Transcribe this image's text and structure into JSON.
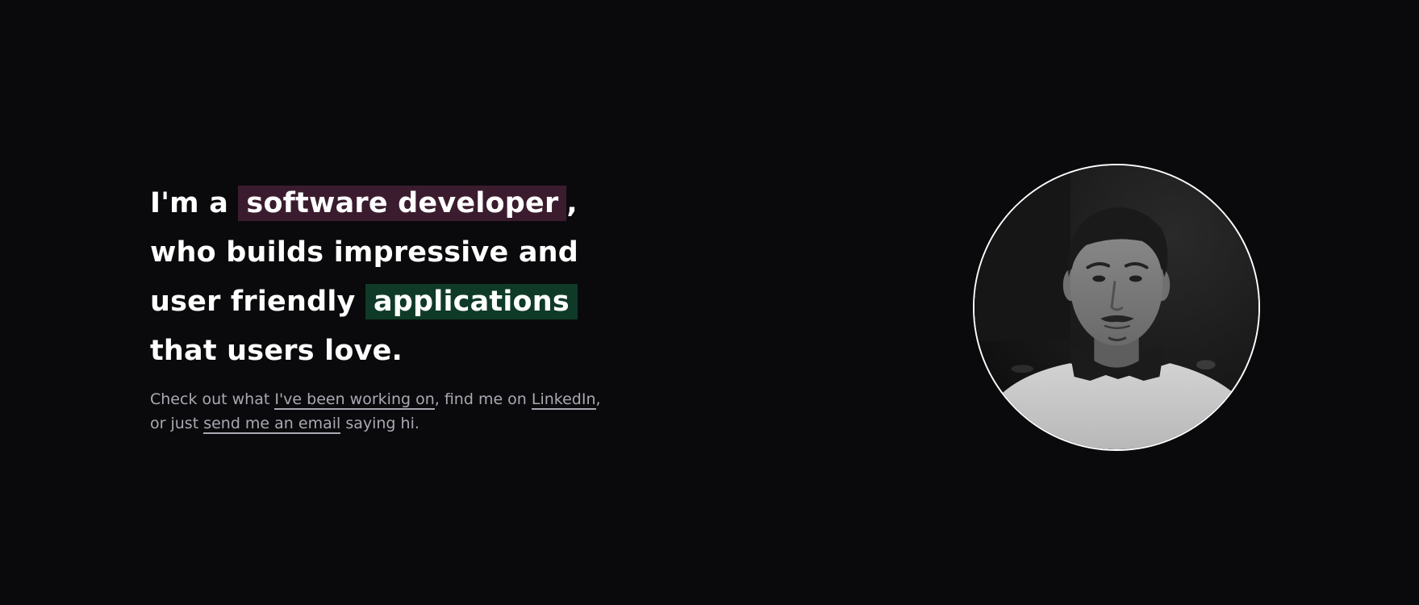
{
  "intro": {
    "line1_prefix": "I'm a ",
    "role_highlight": "software developer",
    "line1_suffix": ",",
    "line2": "who builds impressive and",
    "line3_prefix": "user friendly ",
    "apps_highlight": "applications",
    "line4": "that users love."
  },
  "tagline": {
    "part1": "Check out what ",
    "work_link": "I've been working on",
    "part2": ", find me on ",
    "linkedin_link": "LinkedIn",
    "part3": ",",
    "part4": "or just ",
    "email_link": "send me an email",
    "part5": " saying hi."
  },
  "colors": {
    "background": "#0a0a0c",
    "role_highlight_bg": "#3a1c2e",
    "apps_highlight_bg": "#0f3a27",
    "text_primary": "#ffffff",
    "text_muted": "#a9a9b3"
  },
  "portrait": {
    "icon": "profile-photo"
  }
}
